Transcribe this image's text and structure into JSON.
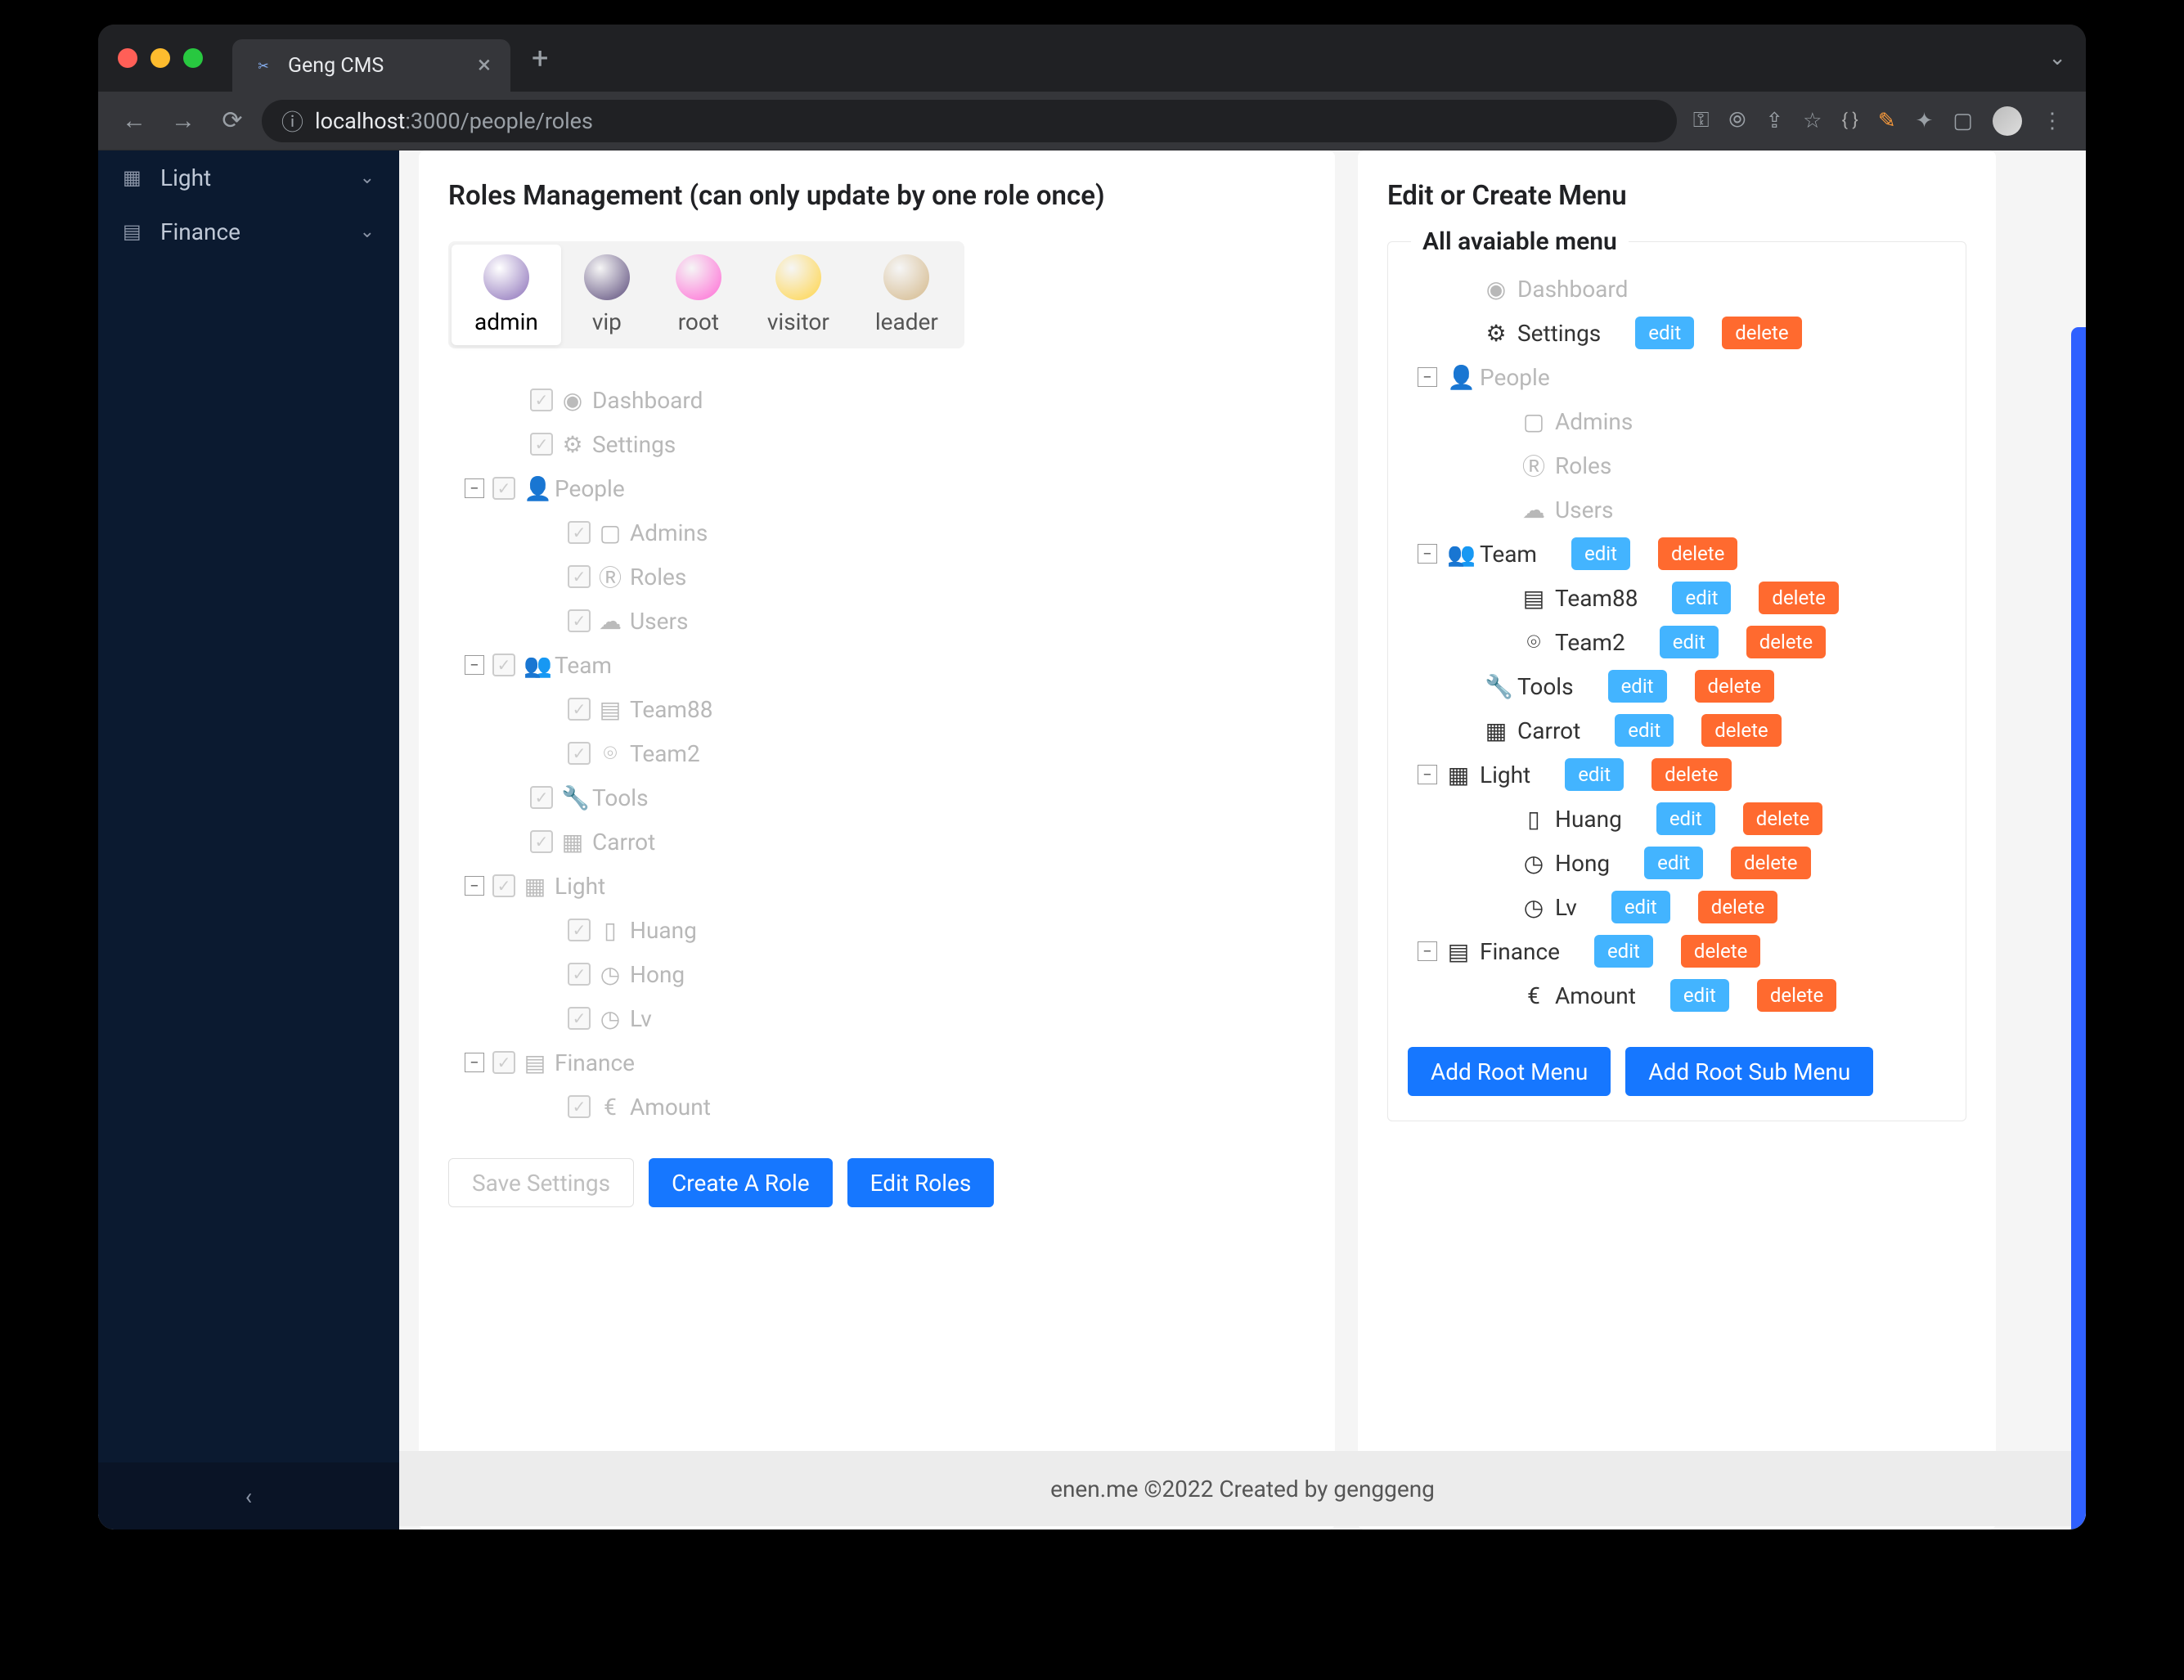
{
  "browser": {
    "tab_title": "Geng CMS",
    "url_proto_host": "localhost",
    "url_port_path": ":3000/people/roles"
  },
  "sidebar": {
    "items": [
      {
        "icon": "▦",
        "label": "Light"
      },
      {
        "icon": "▤",
        "label": "Finance"
      }
    ]
  },
  "roles_card": {
    "title": "Roles Management (can only update by one role once)",
    "roles": [
      {
        "label": "admin",
        "avatar": "#8a6fb8"
      },
      {
        "label": "vip",
        "avatar": "#5a4a7a"
      },
      {
        "label": "root",
        "avatar": "#ff6ad5"
      },
      {
        "label": "visitor",
        "avatar": "#ffd447"
      },
      {
        "label": "leader",
        "avatar": "#d4b88a"
      }
    ],
    "tree": [
      {
        "depth": 1,
        "toggle": false,
        "cb": true,
        "icon": "◉",
        "label": "Dashboard"
      },
      {
        "depth": 1,
        "toggle": false,
        "cb": true,
        "icon": "⚙",
        "label": "Settings"
      },
      {
        "depth": 0,
        "toggle": true,
        "toggle_sym": "−",
        "cb": true,
        "icon": "👤",
        "label": "People"
      },
      {
        "depth": 2,
        "toggle": false,
        "cb": true,
        "icon": "▢",
        "label": "Admins"
      },
      {
        "depth": 2,
        "toggle": false,
        "cb": true,
        "icon": "Ⓡ",
        "label": "Roles"
      },
      {
        "depth": 2,
        "toggle": false,
        "cb": true,
        "icon": "☁",
        "label": "Users"
      },
      {
        "depth": 0,
        "toggle": true,
        "toggle_sym": "−",
        "cb": true,
        "icon": "👥",
        "label": "Team"
      },
      {
        "depth": 2,
        "toggle": false,
        "cb": true,
        "icon": "▤",
        "label": "Team88"
      },
      {
        "depth": 2,
        "toggle": false,
        "cb": true,
        "icon": "⌾",
        "label": "Team2"
      },
      {
        "depth": 1,
        "toggle": false,
        "cb": true,
        "icon": "🔧",
        "label": "Tools"
      },
      {
        "depth": 1,
        "toggle": false,
        "cb": true,
        "icon": "▦",
        "label": "Carrot"
      },
      {
        "depth": 0,
        "toggle": true,
        "toggle_sym": "−",
        "cb": true,
        "icon": "▦",
        "label": "Light"
      },
      {
        "depth": 2,
        "toggle": false,
        "cb": true,
        "icon": "▯",
        "label": "Huang"
      },
      {
        "depth": 2,
        "toggle": false,
        "cb": true,
        "icon": "◷",
        "label": "Hong"
      },
      {
        "depth": 2,
        "toggle": false,
        "cb": true,
        "icon": "◷",
        "label": "Lv"
      },
      {
        "depth": 0,
        "toggle": true,
        "toggle_sym": "−",
        "cb": true,
        "icon": "▤",
        "label": "Finance"
      },
      {
        "depth": 2,
        "toggle": false,
        "cb": true,
        "icon": "€",
        "label": "Amount"
      }
    ],
    "save_label": "Save Settings",
    "create_label": "Create A Role",
    "edit_roles_label": "Edit Roles"
  },
  "menu_card": {
    "title": "Edit or Create Menu",
    "legend": "All avaiable menu",
    "edit_label": "edit",
    "delete_label": "delete",
    "tree": [
      {
        "depth": 1,
        "toggle": false,
        "icon": "◉",
        "label": "Dashboard",
        "dim": true,
        "actions": false
      },
      {
        "depth": 1,
        "toggle": false,
        "icon": "⚙",
        "label": "Settings",
        "dim": false,
        "actions": true
      },
      {
        "depth": 0,
        "toggle": true,
        "toggle_sym": "−",
        "icon": "👤",
        "label": "People",
        "dim": true,
        "actions": false
      },
      {
        "depth": 2,
        "toggle": false,
        "icon": "▢",
        "label": "Admins",
        "dim": true,
        "actions": false
      },
      {
        "depth": 2,
        "toggle": false,
        "icon": "Ⓡ",
        "label": "Roles",
        "dim": true,
        "actions": false
      },
      {
        "depth": 2,
        "toggle": false,
        "icon": "☁",
        "label": "Users",
        "dim": true,
        "actions": false
      },
      {
        "depth": 0,
        "toggle": true,
        "toggle_sym": "−",
        "icon": "👥",
        "label": "Team",
        "dim": false,
        "actions": true
      },
      {
        "depth": 2,
        "toggle": false,
        "icon": "▤",
        "label": "Team88",
        "dim": false,
        "actions": true
      },
      {
        "depth": 2,
        "toggle": false,
        "icon": "⌾",
        "label": "Team2",
        "dim": false,
        "actions": true
      },
      {
        "depth": 1,
        "toggle": false,
        "icon": "🔧",
        "label": "Tools",
        "dim": false,
        "actions": true
      },
      {
        "depth": 1,
        "toggle": false,
        "icon": "▦",
        "label": "Carrot",
        "dim": false,
        "actions": true
      },
      {
        "depth": 0,
        "toggle": true,
        "toggle_sym": "−",
        "icon": "▦",
        "label": "Light",
        "dim": false,
        "actions": true
      },
      {
        "depth": 2,
        "toggle": false,
        "icon": "▯",
        "label": "Huang",
        "dim": false,
        "actions": true
      },
      {
        "depth": 2,
        "toggle": false,
        "icon": "◷",
        "label": "Hong",
        "dim": false,
        "actions": true
      },
      {
        "depth": 2,
        "toggle": false,
        "icon": "◷",
        "label": "Lv",
        "dim": false,
        "actions": true
      },
      {
        "depth": 0,
        "toggle": true,
        "toggle_sym": "−",
        "icon": "▤",
        "label": "Finance",
        "dim": false,
        "actions": true
      },
      {
        "depth": 2,
        "toggle": false,
        "icon": "€",
        "label": "Amount",
        "dim": false,
        "actions": true
      }
    ],
    "add_root_label": "Add Root Menu",
    "add_sub_label": "Add Root Sub Menu"
  },
  "footer": "enen.me ©2022 Created by genggeng"
}
